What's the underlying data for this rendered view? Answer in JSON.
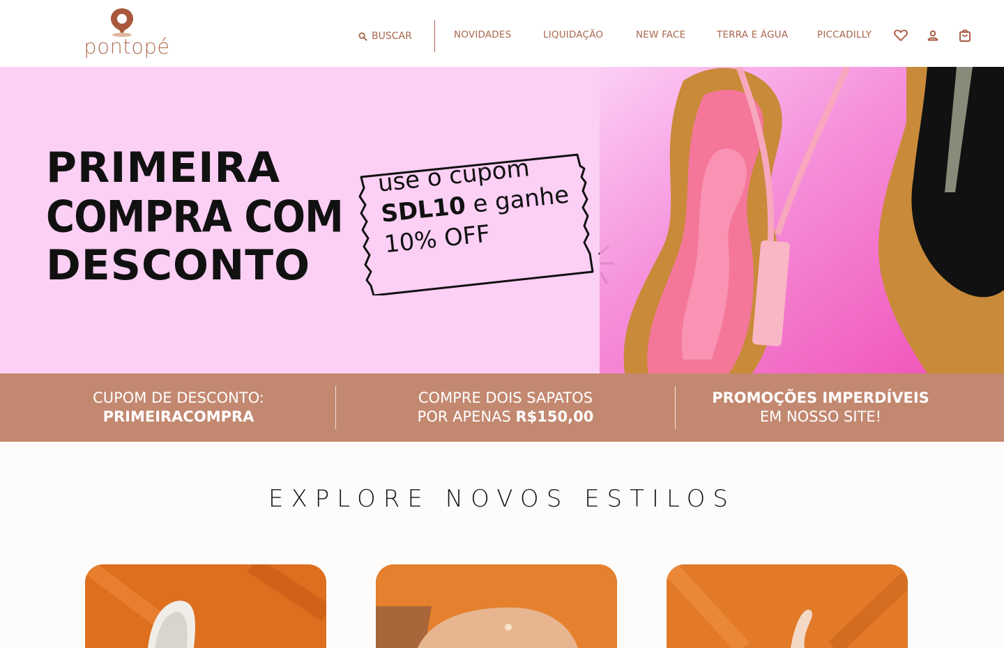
{
  "brand": {
    "logo_text": "pontopé",
    "primary_color": "#b07055"
  },
  "nav": {
    "search_label": "BUSCAR",
    "items": [
      "NOVIDADES",
      "LIQUIDAÇÃO",
      "NEW FACE",
      "TERRA E ÁGUA",
      "PICCADILLY"
    ],
    "icons": [
      "heart-icon",
      "user-icon",
      "bag-icon"
    ]
  },
  "hero": {
    "title_line1": "PRIMEIRA",
    "title_line2": "COMPRA COM",
    "title_line3": "DESCONTO",
    "coupon_line1": "use o cupom",
    "coupon_code": "SDL10",
    "coupon_line2_rest": " e ganhe",
    "coupon_line3": "10% OFF",
    "background_color": "#fccff5"
  },
  "promo_band": {
    "background_color": "#c38870",
    "col1_line1": "CUPOM DE  DESCONTO:",
    "col1_line2": "PRIMEIRACOMPRA",
    "col2_line1": "COMPRE DOIS SAPATOS",
    "col2_line2_prefix": "POR APENAS ",
    "col2_price": "R$150,00",
    "col3_line1": "PROMOÇÕES IMPERDÍVEIS",
    "col3_line2": "EM NOSSO SITE!"
  },
  "explore": {
    "title": "EXPLORE NOVOS ESTILOS",
    "cards": [
      "card-1",
      "card-2",
      "card-3"
    ]
  }
}
